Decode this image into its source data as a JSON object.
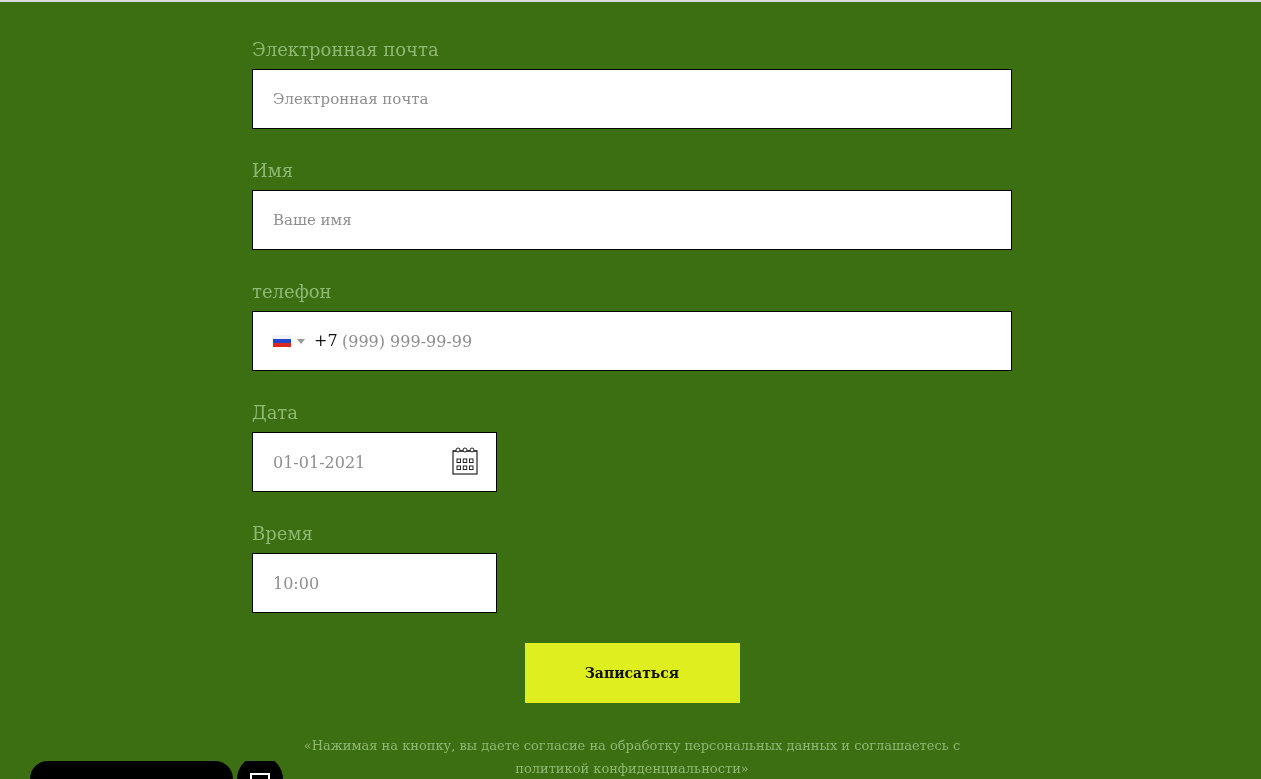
{
  "fields": [
    {
      "kind": "text",
      "label": "Электронная почта",
      "placeholder": "Электронная почта"
    },
    {
      "kind": "text",
      "label": "Имя",
      "placeholder": "Ваше имя"
    },
    {
      "kind": "phone",
      "label": "телефон",
      "prefix": "+7",
      "placeholder": "(999) 999-99-99"
    },
    {
      "kind": "date",
      "label": "Дата",
      "placeholder": "01-01-2021"
    },
    {
      "kind": "time",
      "label": "Время",
      "placeholder": "10:00"
    }
  ],
  "submit": {
    "label": "Записаться"
  },
  "consent": "«Нажимая на кнопку, вы даете согласие на обработку персональных данных и соглашаетесь с политикой конфиденциальности»"
}
